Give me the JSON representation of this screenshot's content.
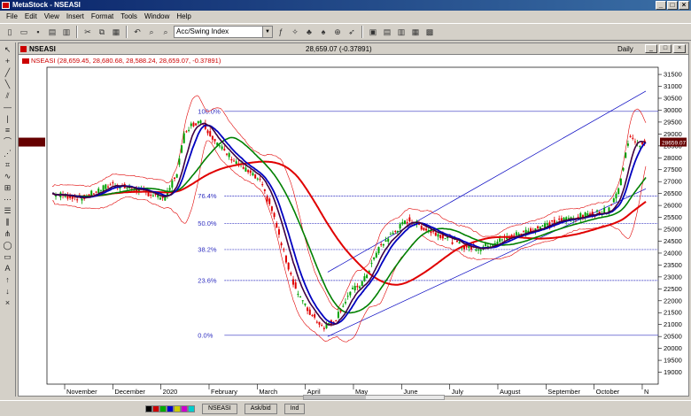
{
  "window": {
    "title": "MetaStock - NSEASI",
    "min_symbol": "_",
    "max_symbol": "□",
    "close_symbol": "×"
  },
  "menu": [
    {
      "label": "File"
    },
    {
      "label": "Edit"
    },
    {
      "label": "View"
    },
    {
      "label": "Insert"
    },
    {
      "label": "Format"
    },
    {
      "label": "Tools"
    },
    {
      "label": "Window"
    },
    {
      "label": "Help"
    }
  ],
  "toolbar": {
    "indicator_combo_value": "Acc/Swing Index"
  },
  "chart_window": {
    "symbol": "NSEASI",
    "price_readout": "28,659.07 (-0.37891)",
    "period": "Daily",
    "legend": "NSEASI (28,659.45, 28,680.68, 28,588.24, 28,659.07, -0.37891)",
    "last_price_tag": "28659.07"
  },
  "chart_data": {
    "type": "candlestick",
    "ylim": [
      18500,
      31800
    ],
    "yticks": [
      19000,
      19500,
      20000,
      20500,
      21000,
      21500,
      22000,
      22500,
      23000,
      23500,
      24000,
      24500,
      25000,
      25500,
      26000,
      26500,
      27000,
      27500,
      28000,
      28500,
      29000,
      29500,
      30000,
      30500,
      31000,
      31500
    ],
    "months": [
      "November",
      "December",
      "2020",
      "February",
      "March",
      "April",
      "May",
      "June",
      "July",
      "August",
      "September",
      "October",
      "N"
    ],
    "price_series_ohlc_summary": [
      {
        "month": "November",
        "close": 26600
      },
      {
        "month": "December",
        "close": 26800
      },
      {
        "month": "2020",
        "close": 29500
      },
      {
        "month": "February",
        "close": 27400
      },
      {
        "month": "March",
        "close": 21000
      },
      {
        "month": "April",
        "close": 22200
      },
      {
        "month": "May",
        "close": 25300
      },
      {
        "month": "June",
        "close": 24600
      },
      {
        "month": "July",
        "close": 24200
      },
      {
        "month": "August",
        "close": 25100
      },
      {
        "month": "September",
        "close": 25800
      },
      {
        "month": "October",
        "close": 28659
      }
    ],
    "fibonacci_levels": [
      {
        "label": "100.0%",
        "value": 29950
      },
      {
        "label": "76.4%",
        "value": 26400
      },
      {
        "label": "50.0%",
        "value": 25250
      },
      {
        "label": "38.2%",
        "value": 24150
      },
      {
        "label": "23.6%",
        "value": 22850
      },
      {
        "label": "0.0%",
        "value": 20550
      }
    ],
    "colors": {
      "up": "#00a000",
      "down": "#e00000",
      "ma_long": "#e00000",
      "ma_mid": "#008000",
      "ma_fast_blue": "#0000c0",
      "ma_fast_purple": "#400040",
      "bands": "#e00000",
      "trend": "#0000c0",
      "fib": "#3030c0"
    }
  },
  "statusbar": {
    "tabs": [
      {
        "label": "NSEASI"
      },
      {
        "label": "Ask/bid"
      },
      {
        "label": "Ind"
      }
    ]
  }
}
